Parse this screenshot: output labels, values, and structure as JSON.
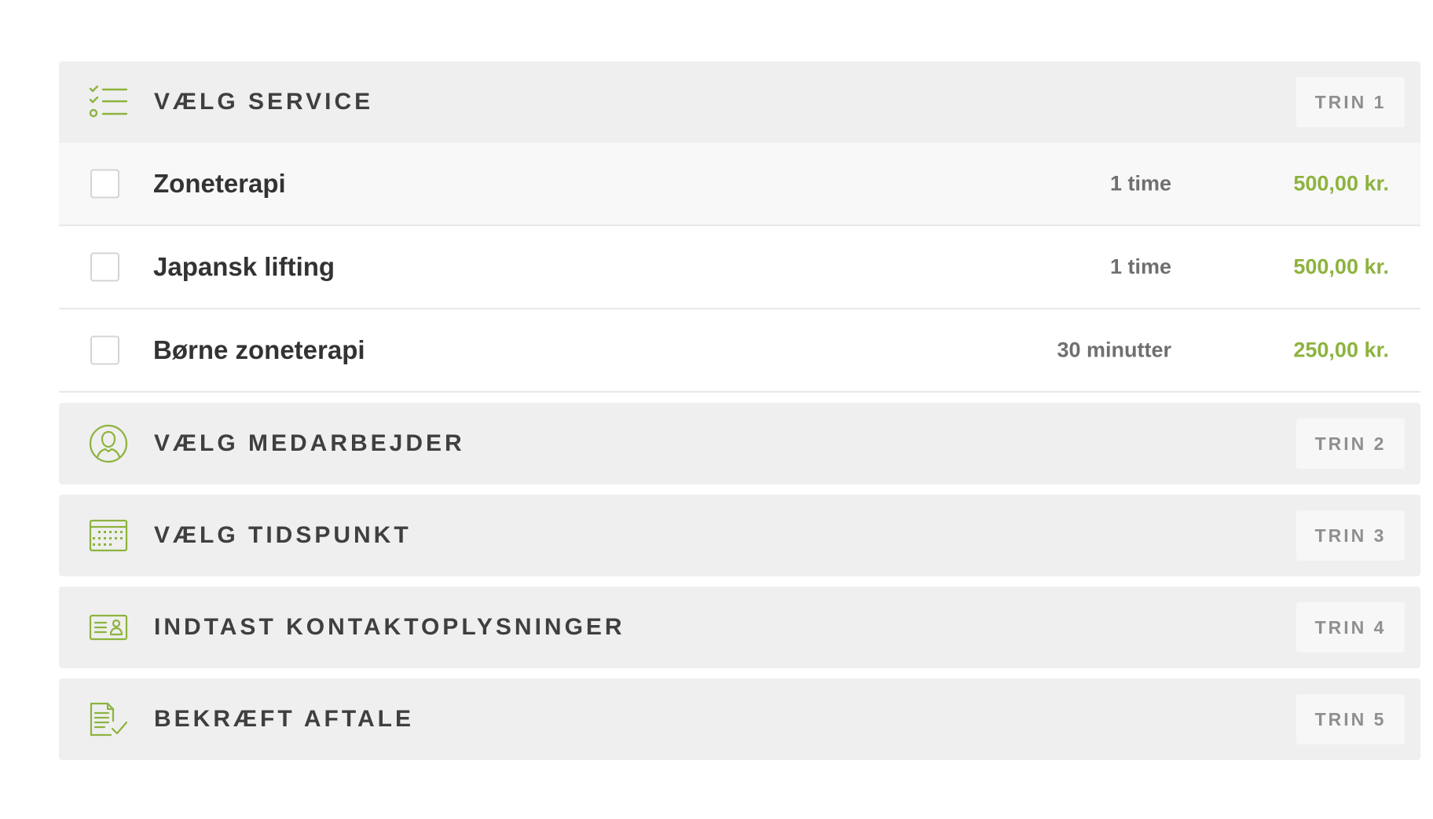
{
  "colors": {
    "accent": "#8db33e",
    "header_bg": "#efefef",
    "badge_bg": "#f7f7f7",
    "title_text": "#3f3f3f",
    "badge_text": "#8f8f8f",
    "duration_text": "#6f6f6f"
  },
  "steps": [
    {
      "title": "VÆLG SERVICE",
      "badge": "TRIN 1",
      "icon": "checklist-icon"
    },
    {
      "title": "VÆLG MEDARBEJDER",
      "badge": "TRIN 2",
      "icon": "user-circle-icon"
    },
    {
      "title": "VÆLG TIDSPUNKT",
      "badge": "TRIN 3",
      "icon": "calendar-icon"
    },
    {
      "title": "INDTAST KONTAKTOPLYSNINGER",
      "badge": "TRIN 4",
      "icon": "contact-card-icon"
    },
    {
      "title": "BEKRÆFT AFTALE",
      "badge": "TRIN 5",
      "icon": "document-check-icon"
    }
  ],
  "services": [
    {
      "name": "Zoneterapi",
      "duration": "1 time",
      "price": "500,00 kr.",
      "checked": false
    },
    {
      "name": "Japansk lifting",
      "duration": "1 time",
      "price": "500,00 kr.",
      "checked": false
    },
    {
      "name": "Børne zoneterapi",
      "duration": "30 minutter",
      "price": "250,00 kr.",
      "checked": false
    }
  ]
}
